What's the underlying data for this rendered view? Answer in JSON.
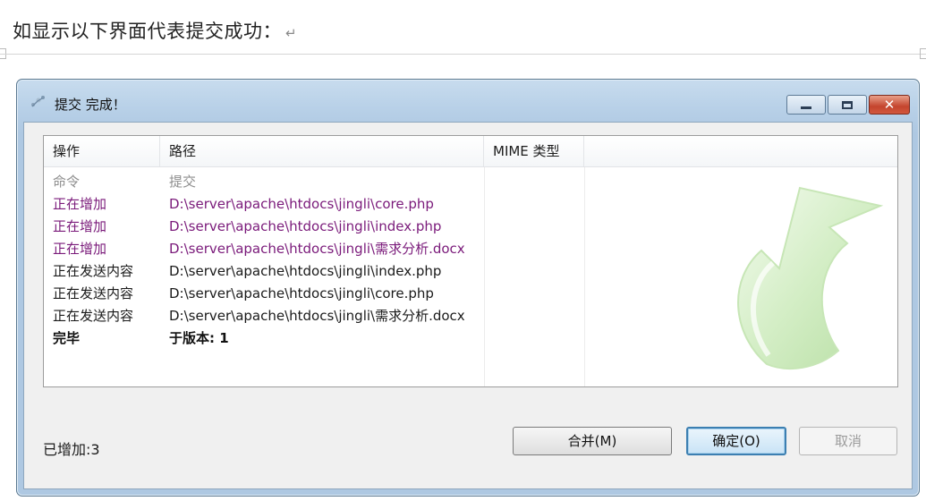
{
  "doc": {
    "caption": "如显示以下界面代表提交成功：",
    "para_mark": "↵"
  },
  "window": {
    "title": "提交 完成！",
    "icon": "commit-icon",
    "controls": {
      "minimize": "minimize-icon",
      "maximize": "maximize-icon",
      "close": "✕"
    }
  },
  "list": {
    "columns": [
      "操作",
      "路径",
      "MIME 类型"
    ],
    "rows": [
      {
        "action": "命令",
        "path": "提交",
        "style": "gray"
      },
      {
        "action": "正在增加",
        "path": "D:\\server\\apache\\htdocs\\jingli\\core.php",
        "style": "purple"
      },
      {
        "action": "正在增加",
        "path": "D:\\server\\apache\\htdocs\\jingli\\index.php",
        "style": "purple"
      },
      {
        "action": "正在增加",
        "path": "D:\\server\\apache\\htdocs\\jingli\\需求分析.docx",
        "style": "purple"
      },
      {
        "action": "正在发送内容",
        "path": "D:\\server\\apache\\htdocs\\jingli\\index.php",
        "style": "normal"
      },
      {
        "action": "正在发送内容",
        "path": "D:\\server\\apache\\htdocs\\jingli\\core.php",
        "style": "normal"
      },
      {
        "action": "正在发送内容",
        "path": "D:\\server\\apache\\htdocs\\jingli\\需求分析.docx",
        "style": "normal"
      },
      {
        "action": "完毕",
        "path": "于版本: 1",
        "style": "bold"
      }
    ]
  },
  "status": {
    "added": "已增加:3"
  },
  "buttons": {
    "merge": "合并(M)",
    "ok": "确定(O)",
    "cancel": "取消"
  },
  "colors": {
    "added_row": "#7a1a7a",
    "command_row": "#8e8e8e",
    "title_bg": "#b9d1e8",
    "close_btn": "#c4452e"
  }
}
